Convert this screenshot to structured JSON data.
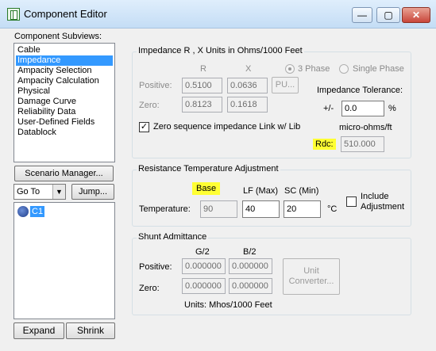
{
  "window": {
    "title": "Component Editor",
    "min_glyph": "—",
    "max_glyph": "▢",
    "close_glyph": "✕"
  },
  "left": {
    "subviews_label": "Component Subviews:",
    "subviews": [
      "Cable",
      "Impedance",
      "Ampacity Selection",
      "Ampacity Calculation",
      "Physical",
      "Damage Curve",
      "Reliability Data",
      "User-Defined Fields",
      "Datablock"
    ],
    "selected_subview": "Impedance",
    "scenario_button": "Scenario Manager...",
    "goto_value": "Go To",
    "jump_button": "Jump...",
    "tree_item": "C1",
    "expand_button": "Expand",
    "shrink_button": "Shrink"
  },
  "impedance": {
    "group_title": "Impedance R , X Units in Ohms/1000 Feet",
    "col_r": "R",
    "col_x": "X",
    "positive_label": "Positive:",
    "zero_label": "Zero:",
    "pos_r": "0.5100",
    "pos_x": "0.0636",
    "zero_r": "0.8123",
    "zero_x": "0.1618",
    "pu_button": "PU...",
    "three_phase": "3 Phase",
    "single_phase": "Single Phase",
    "tolerance_label": "Impedance Tolerance:",
    "pm_label": "+/-",
    "tolerance_value": "0.0",
    "pct": "%",
    "link_label": "Zero sequence impedance Link w/ Lib",
    "micro_label": "micro-ohms/ft",
    "rdc_label": "Rdc:",
    "rdc_value": "510.000"
  },
  "resistance": {
    "group_title": "Resistance Temperature Adjustment",
    "base_label": "Base",
    "lf_label": "LF (Max)",
    "sc_label": "SC (Min)",
    "temp_label": "Temperature:",
    "base_value": "90",
    "lf_value": "40",
    "sc_value": "20",
    "unit": "°C",
    "include_label_1": "Include",
    "include_label_2": "Adjustment"
  },
  "shunt": {
    "group_title": "Shunt Admittance",
    "g_label": "G/2",
    "b_label": "B/2",
    "positive_label": "Positive:",
    "zero_label": "Zero:",
    "pos_g": "0.000000",
    "pos_b": "0.000000",
    "zero_g": "0.000000",
    "zero_b": "0.000000",
    "unit_btn_1": "Unit",
    "unit_btn_2": "Converter...",
    "units_text": "Units:  Mhos/1000 Feet"
  }
}
